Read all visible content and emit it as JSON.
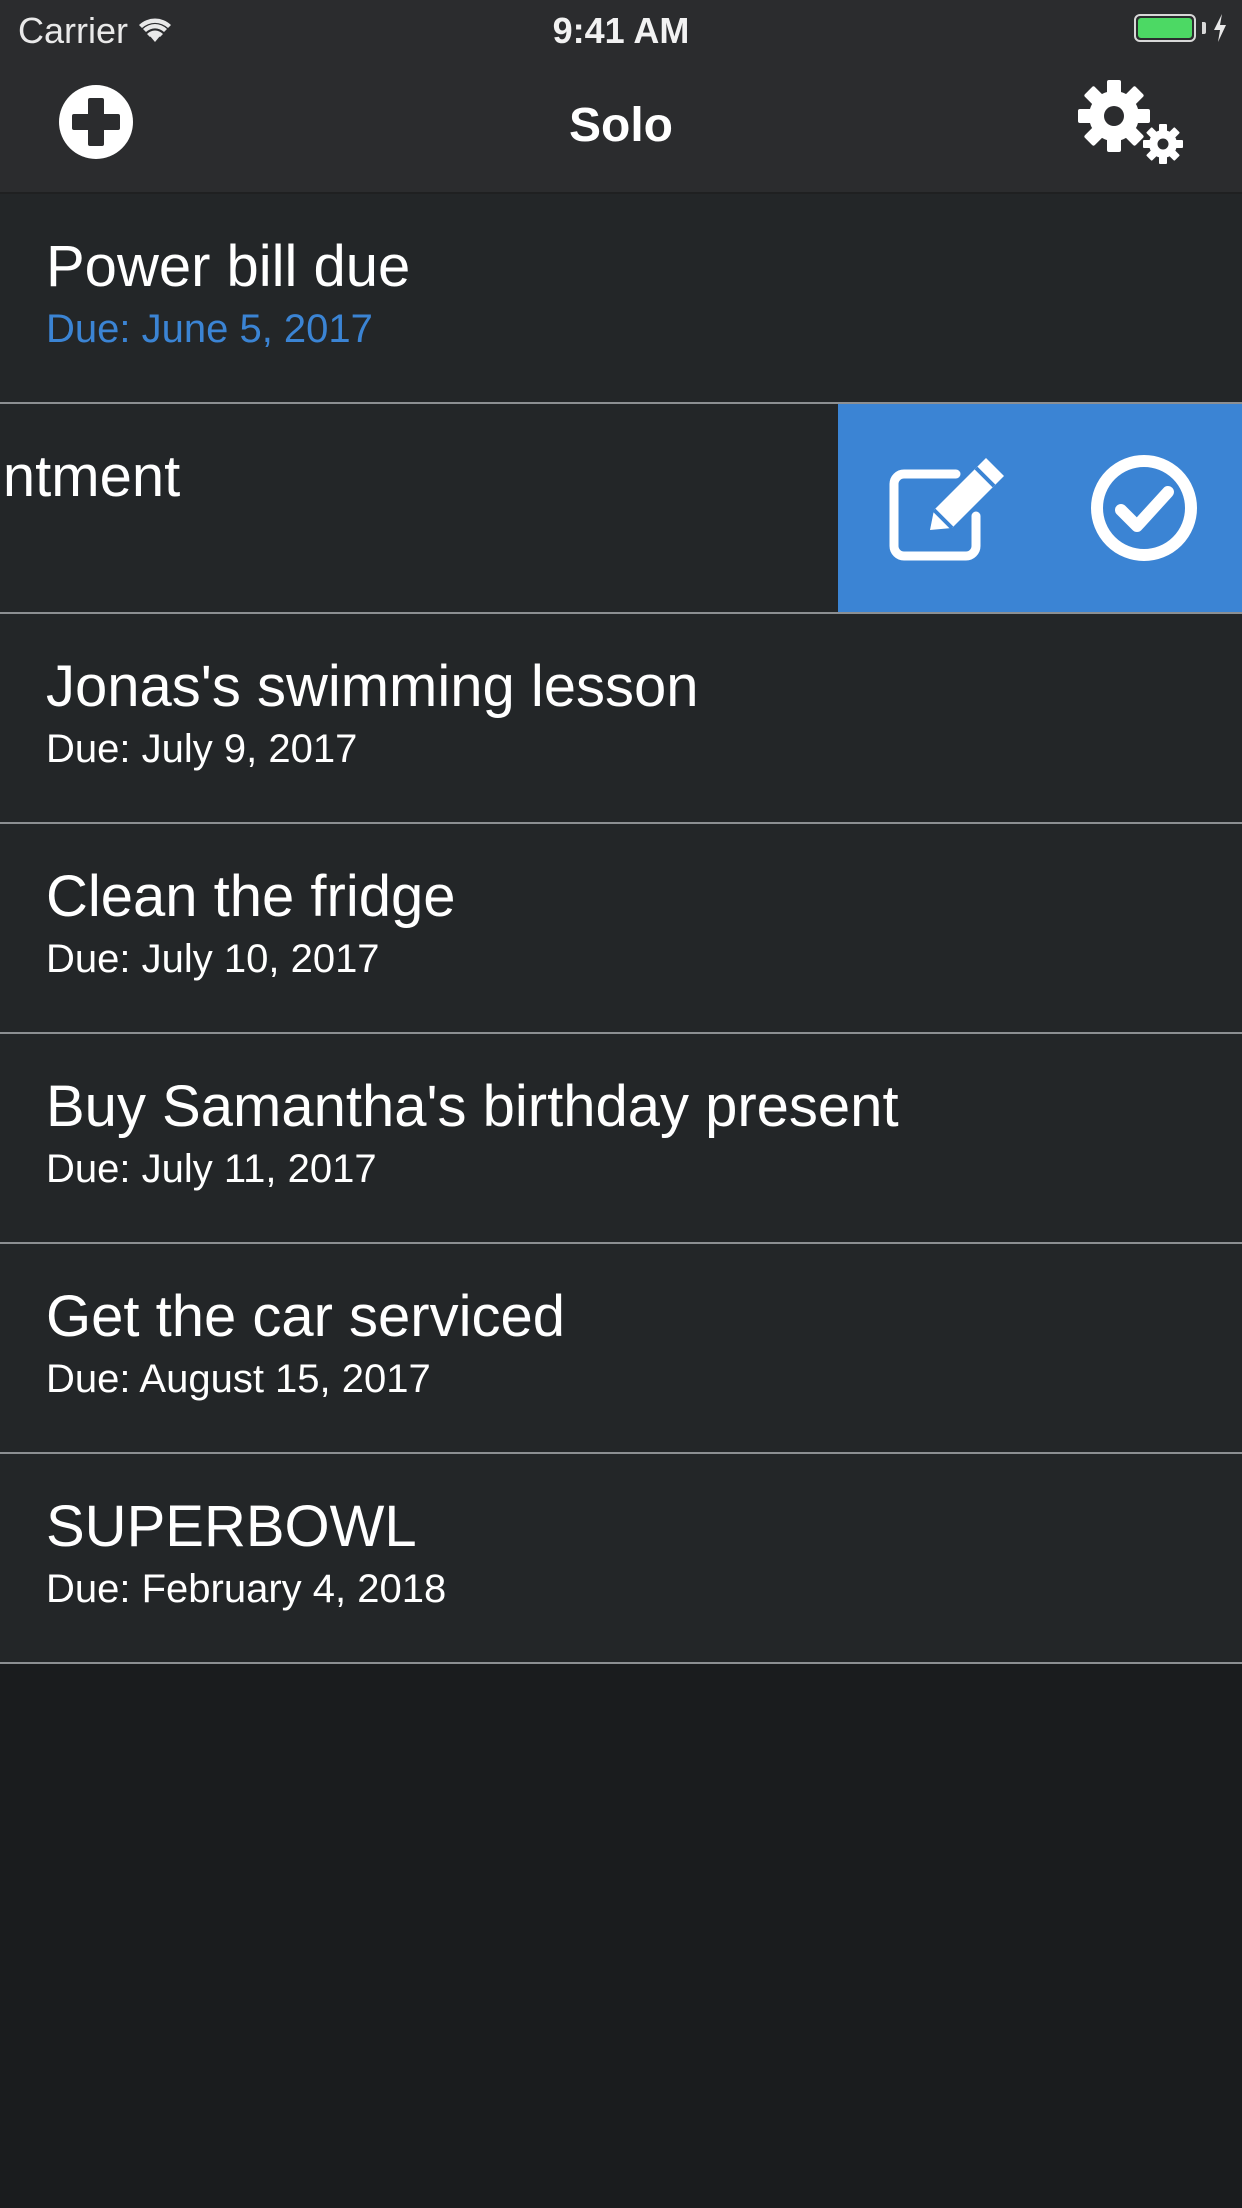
{
  "status_bar": {
    "carrier": "Carrier",
    "time": "9:41 AM",
    "battery_color": "#4cd964"
  },
  "nav": {
    "title": "Solo",
    "add_icon": "plus-circle-icon",
    "settings_icon": "gears-icon"
  },
  "colors": {
    "accent": "#3b84d4",
    "row_background": "#232628",
    "bar_background": "#2b2c2e"
  },
  "tasks": [
    {
      "title": "Power bill due",
      "due": "Due: June 5, 2017",
      "highlighted": true
    },
    {
      "title": "intment",
      "due": "",
      "swiped": true
    },
    {
      "title": "Jonas's swimming lesson",
      "due": "Due: July 9, 2017"
    },
    {
      "title": "Clean the fridge",
      "due": "Due: July 10, 2017"
    },
    {
      "title": "Buy Samantha's birthday present",
      "due": "Due: July 11, 2017"
    },
    {
      "title": "Get the car serviced",
      "due": "Due: August 15, 2017"
    },
    {
      "title": "SUPERBOWL",
      "due": "Due: February 4, 2018"
    }
  ],
  "swipe_actions": {
    "edit_icon": "edit-icon",
    "complete_icon": "check-circle-icon"
  }
}
